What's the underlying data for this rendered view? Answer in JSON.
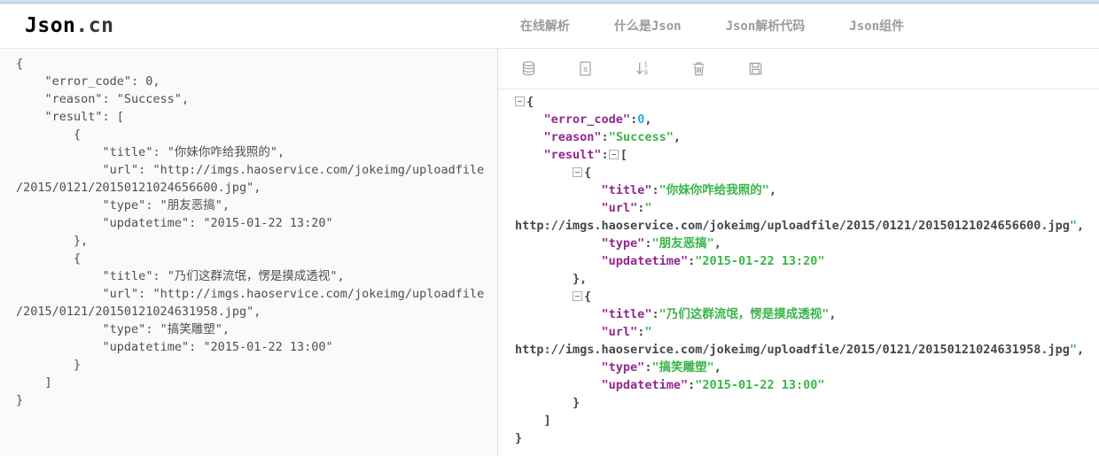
{
  "page": {
    "title": "Json.cn"
  },
  "colors": {
    "brand_green": "#22c28d",
    "key": "#92278f",
    "number": "#25aae2",
    "string": "#3ab54a",
    "icon_gray": "#a2a2a2",
    "topstrip_blue": "#cfe1f0"
  },
  "header": {
    "logo": {
      "brand": "Json",
      "suffix": ".cn"
    },
    "nav": [
      {
        "label": "在线解析"
      },
      {
        "label": "什么是Json"
      },
      {
        "label": "Json解析代码"
      },
      {
        "label": "Json组件"
      }
    ]
  },
  "toolbar": {
    "icons": [
      "database-icon",
      "file-x-icon",
      "sort-numeric-icon",
      "trash-icon",
      "save-icon"
    ]
  },
  "left_editor": {
    "text": "{\n    \"error_code\": 0,\n    \"reason\": \"Success\",\n    \"result\": [\n        {\n            \"title\": \"你妹你咋给我照的\",\n            \"url\": \"http://imgs.haoservice.com/jokeimg/uploadfile\n/2015/0121/20150121024656600.jpg\",\n            \"type\": \"朋友恶搞\",\n            \"updatetime\": \"2015-01-22 13:20\"\n        },\n        {\n            \"title\": \"乃们这群流氓，愣是摸成透视\",\n            \"url\": \"http://imgs.haoservice.com/jokeimg/uploadfile\n/2015/0121/20150121024631958.jpg\",\n            \"type\": \"搞笑雕塑\",\n            \"updatetime\": \"2015-01-22 13:00\"\n        }\n    ]\n}"
  },
  "right_viewer": {
    "lines": [
      [
        {
          "t": "collapse"
        },
        {
          "t": "plain",
          "x": "{"
        }
      ],
      [
        {
          "t": "plain",
          "x": "    "
        },
        {
          "t": "key",
          "x": "\"error_code\""
        },
        {
          "t": "plain",
          "x": ":"
        },
        {
          "t": "num",
          "x": "0"
        },
        {
          "t": "plain",
          "x": ","
        }
      ],
      [
        {
          "t": "plain",
          "x": "    "
        },
        {
          "t": "key",
          "x": "\"reason\""
        },
        {
          "t": "plain",
          "x": ":"
        },
        {
          "t": "str",
          "x": "\"Success\""
        },
        {
          "t": "plain",
          "x": ","
        }
      ],
      [
        {
          "t": "plain",
          "x": "    "
        },
        {
          "t": "key",
          "x": "\"result\""
        },
        {
          "t": "plain",
          "x": ":"
        },
        {
          "t": "collapse"
        },
        {
          "t": "plain",
          "x": "["
        }
      ],
      [
        {
          "t": "plain",
          "x": "        "
        },
        {
          "t": "collapse"
        },
        {
          "t": "plain",
          "x": "{"
        }
      ],
      [
        {
          "t": "plain",
          "x": "            "
        },
        {
          "t": "key",
          "x": "\"title\""
        },
        {
          "t": "plain",
          "x": ":"
        },
        {
          "t": "str",
          "x": "\"你妹你咋给我照的\""
        },
        {
          "t": "plain",
          "x": ","
        }
      ],
      [
        {
          "t": "plain",
          "x": "            "
        },
        {
          "t": "key",
          "x": "\"url\""
        },
        {
          "t": "plain",
          "x": ":"
        },
        {
          "t": "str",
          "x": "\""
        }
      ],
      [
        {
          "t": "link",
          "x": "http://imgs.haoservice.com/jokeimg/uploadfile/2015/0121/20150121024656600.jpg"
        },
        {
          "t": "str",
          "x": "\""
        },
        {
          "t": "plain",
          "x": ","
        }
      ],
      [
        {
          "t": "plain",
          "x": "            "
        },
        {
          "t": "key",
          "x": "\"type\""
        },
        {
          "t": "plain",
          "x": ":"
        },
        {
          "t": "str",
          "x": "\"朋友恶搞\""
        },
        {
          "t": "plain",
          "x": ","
        }
      ],
      [
        {
          "t": "plain",
          "x": "            "
        },
        {
          "t": "key",
          "x": "\"updatetime\""
        },
        {
          "t": "plain",
          "x": ":"
        },
        {
          "t": "str",
          "x": "\"2015-01-22 13:20\""
        }
      ],
      [
        {
          "t": "plain",
          "x": "        },"
        }
      ],
      [
        {
          "t": "plain",
          "x": "        "
        },
        {
          "t": "collapse"
        },
        {
          "t": "plain",
          "x": "{"
        }
      ],
      [
        {
          "t": "plain",
          "x": "            "
        },
        {
          "t": "key",
          "x": "\"title\""
        },
        {
          "t": "plain",
          "x": ":"
        },
        {
          "t": "str",
          "x": "\"乃们这群流氓，愣是摸成透视\""
        },
        {
          "t": "plain",
          "x": ","
        }
      ],
      [
        {
          "t": "plain",
          "x": "            "
        },
        {
          "t": "key",
          "x": "\"url\""
        },
        {
          "t": "plain",
          "x": ":"
        },
        {
          "t": "str",
          "x": "\""
        }
      ],
      [
        {
          "t": "link",
          "x": "http://imgs.haoservice.com/jokeimg/uploadfile/2015/0121/20150121024631958.jpg"
        },
        {
          "t": "str",
          "x": "\""
        },
        {
          "t": "plain",
          "x": ","
        }
      ],
      [
        {
          "t": "plain",
          "x": "            "
        },
        {
          "t": "key",
          "x": "\"type\""
        },
        {
          "t": "plain",
          "x": ":"
        },
        {
          "t": "str",
          "x": "\"搞笑雕塑\""
        },
        {
          "t": "plain",
          "x": ","
        }
      ],
      [
        {
          "t": "plain",
          "x": "            "
        },
        {
          "t": "key",
          "x": "\"updatetime\""
        },
        {
          "t": "plain",
          "x": ":"
        },
        {
          "t": "str",
          "x": "\"2015-01-22 13:00\""
        }
      ],
      [
        {
          "t": "plain",
          "x": "        }"
        }
      ],
      [
        {
          "t": "plain",
          "x": "    ]"
        }
      ],
      [
        {
          "t": "plain",
          "x": "}"
        }
      ]
    ]
  }
}
